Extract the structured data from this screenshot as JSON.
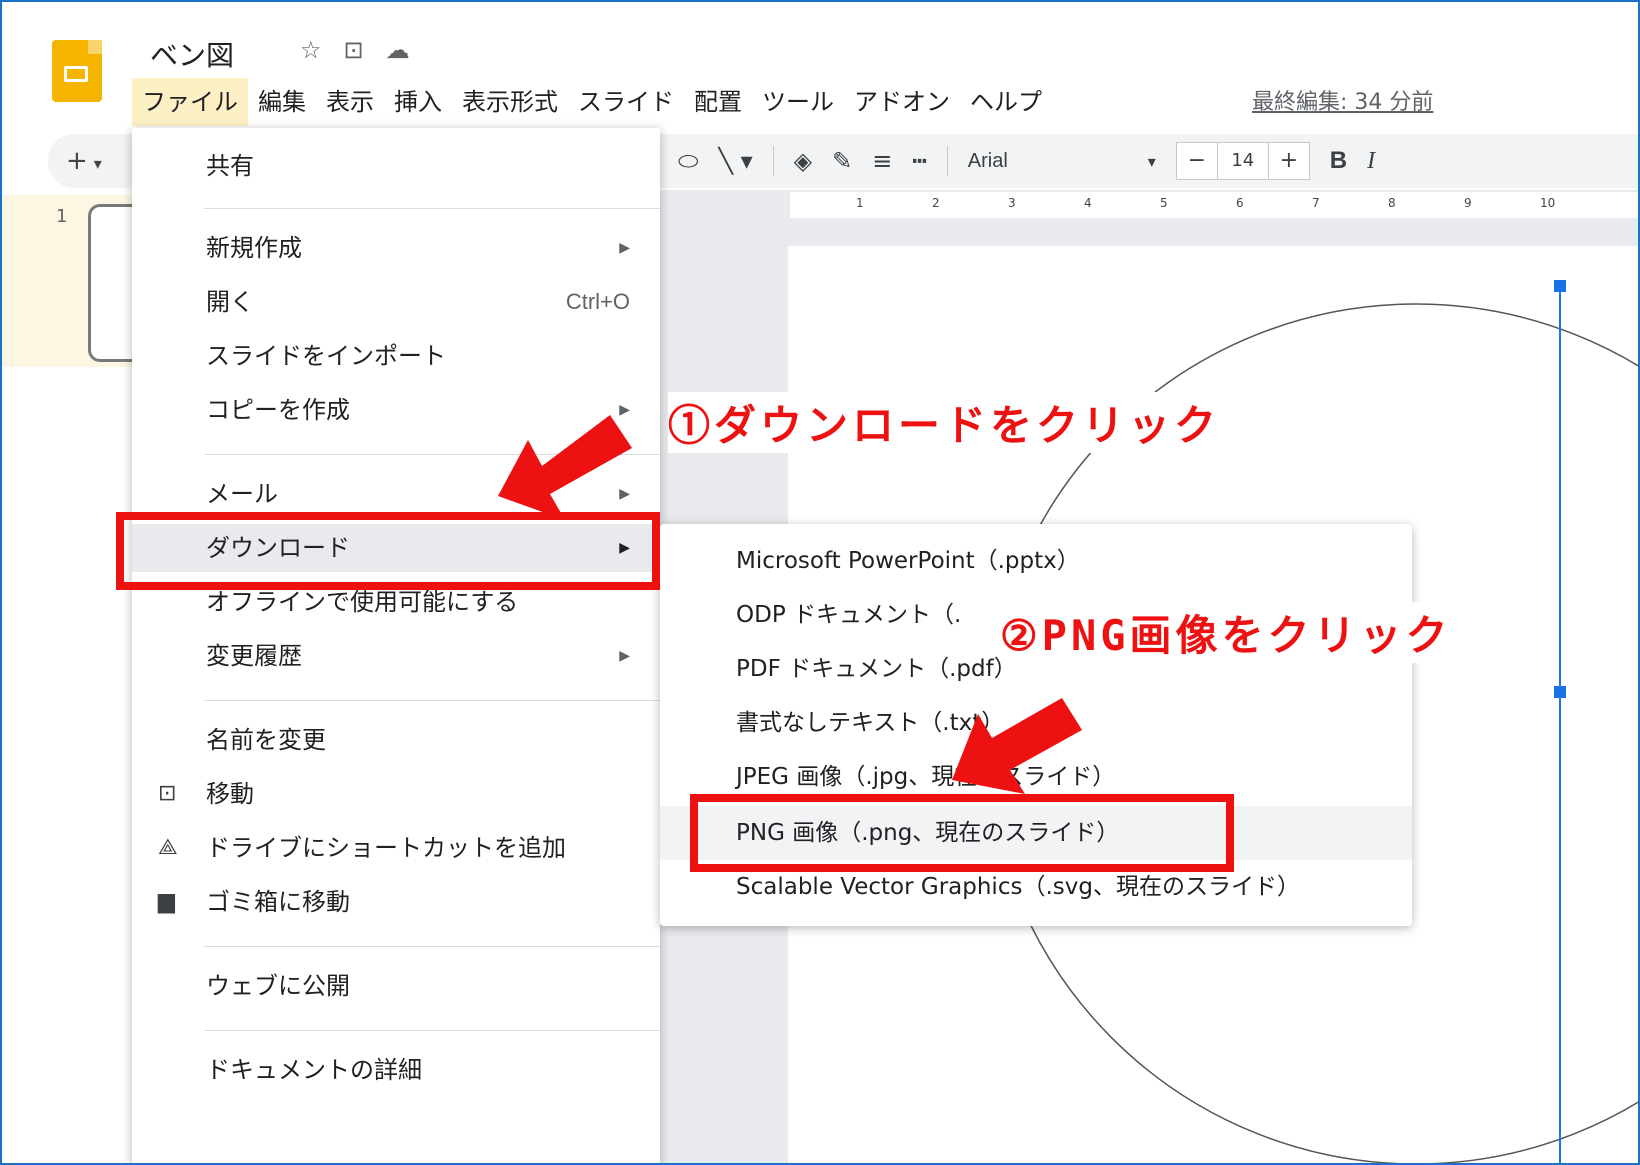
{
  "doc": {
    "title": "ベン図",
    "star_icon": "☆",
    "move_icon": "⊡",
    "cloud_icon": "☁"
  },
  "menubar": {
    "items": [
      "ファイル",
      "編集",
      "表示",
      "挿入",
      "表示形式",
      "スライド",
      "配置",
      "ツール",
      "アドオン",
      "ヘルプ"
    ],
    "active": "ファイル",
    "last_edit": "最終編集: 34 分前"
  },
  "toolbar": {
    "new_slide": "+",
    "font": "Arial",
    "font_size": "14",
    "minus": "−",
    "plus": "+",
    "bold": "B",
    "italic": "I"
  },
  "sidebar": {
    "slide_number": "1"
  },
  "ruler": {
    "ticks": [
      "1",
      "2",
      "3",
      "4",
      "5",
      "6",
      "7",
      "8",
      "9",
      "10"
    ]
  },
  "file_menu": {
    "items": [
      {
        "label": "共有"
      },
      {
        "label": "新規作成",
        "submenu": true
      },
      {
        "label": "開く",
        "shortcut": "Ctrl+O"
      },
      {
        "label": "スライドをインポート"
      },
      {
        "label": "コピーを作成",
        "submenu": true
      },
      {
        "label": "メール",
        "submenu": true
      },
      {
        "label": "ダウンロード",
        "submenu": true,
        "highlighted": true
      },
      {
        "label": "オフラインで使用可能にする"
      },
      {
        "label": "変更履歴",
        "submenu": true
      },
      {
        "label": "名前を変更"
      },
      {
        "label": "移動",
        "icon": "move-icon"
      },
      {
        "label": "ドライブにショートカットを追加",
        "icon": "drive-shortcut-icon"
      },
      {
        "label": "ゴミ箱に移動",
        "icon": "trash-icon"
      },
      {
        "label": "ウェブに公開"
      },
      {
        "label": "ドキュメントの詳細"
      }
    ]
  },
  "download_submenu": {
    "items": [
      "Microsoft PowerPoint（.pptx）",
      "ODP ドキュメント（.",
      "PDF ドキュメント（.pdf）",
      "書式なしテキスト（.txt）",
      "JPEG 画像（.jpg、現在のスライド）",
      "PNG 画像（.png、現在のスライド）",
      "Scalable Vector Graphics（.svg、現在のスライド）"
    ],
    "highlighted_index": 5
  },
  "annotations": {
    "step1": "①ダウンロードをクリック",
    "step2": "②PNG画像をクリック",
    "color": "#ee1111"
  }
}
